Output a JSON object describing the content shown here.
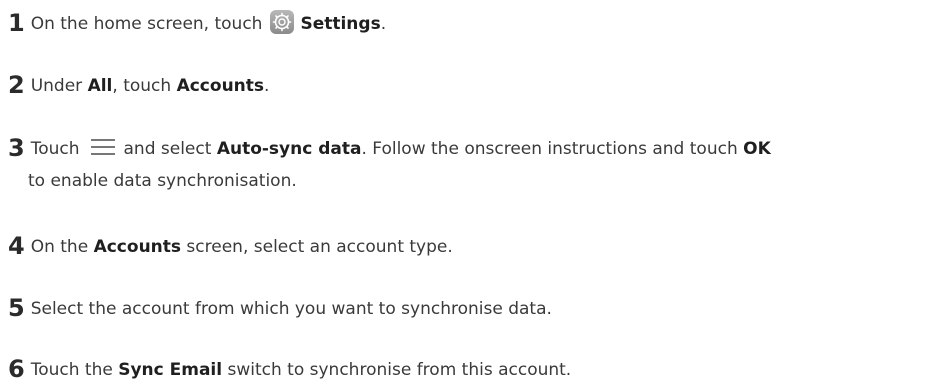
{
  "steps": [
    {
      "num": "1",
      "t1": "On the home screen, touch",
      "b1": "Settings",
      "t2": "."
    },
    {
      "num": "2",
      "t1": "Under ",
      "b1": "All",
      "t2": ", touch ",
      "b2": "Accounts",
      "t3": "."
    },
    {
      "num": "3",
      "t1": "Touch",
      "t2": "and select ",
      "b1": "Auto-sync data",
      "t3": ". Follow the onscreen instructions and touch ",
      "b2": "OK",
      "cont": "to enable data synchronisation."
    },
    {
      "num": "4",
      "t1": "On the ",
      "b1": "Accounts",
      "t2": " screen, select an account type."
    },
    {
      "num": "5",
      "t1": "Select the account from which you want to synchronise data."
    },
    {
      "num": "6",
      "t1": "Touch the ",
      "b1": "Sync Email",
      "t2": " switch to synchronise from this account."
    }
  ],
  "icons": {
    "settings": "settings-gear-icon",
    "menu": "menu-lines-icon"
  },
  "colors": {
    "text": "#3a3a3a",
    "bold": "#1f1f1f",
    "icon_bg": "#9a9a9a"
  }
}
